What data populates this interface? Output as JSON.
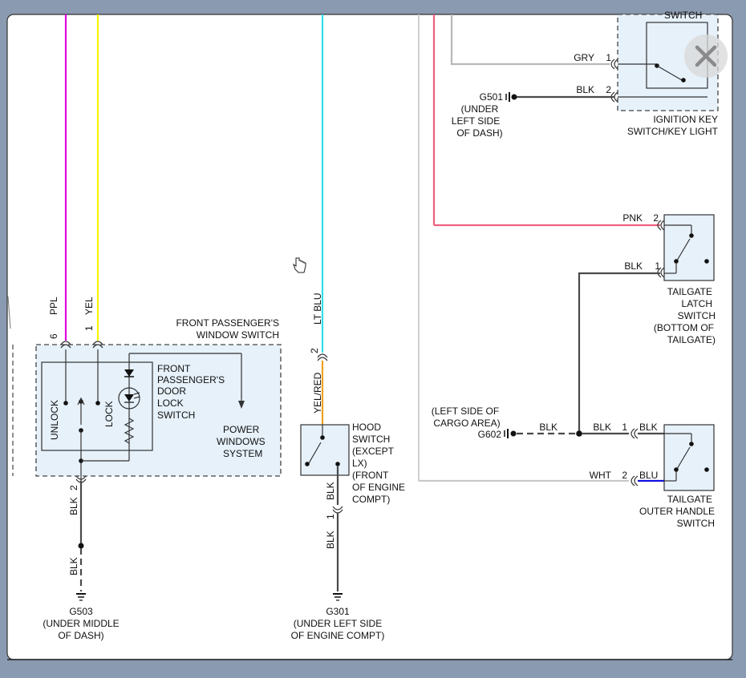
{
  "close_icon": "close-icon",
  "cursor_icon": "hand-pointer-icon",
  "wires": {
    "ppl": "PPL",
    "yel": "YEL",
    "lt_blu": "LT BLU",
    "yel_red": "YEL/RED",
    "blk": "BLK",
    "gry": "GRY",
    "pnk": "PNK",
    "wht": "WHT",
    "blu": "BLU"
  },
  "pins": {
    "p1": "1",
    "p2": "2",
    "p6": "6"
  },
  "components": {
    "window_switch": [
      "FRONT PASSENGER'S",
      "WINDOW SWITCH"
    ],
    "door_lock_switch": [
      "FRONT",
      "PASSENGER'S",
      "DOOR",
      "LOCK",
      "SWITCH"
    ],
    "power_windows": [
      "POWER",
      "WINDOWS",
      "SYSTEM"
    ],
    "unlock": "UNLOCK",
    "lock": "LOCK",
    "hood_switch": [
      "HOOD",
      "SWITCH",
      "(EXCEPT",
      "LX)",
      "(FRONT",
      "OF ENGINE",
      "COMPT)"
    ],
    "ignition_switch_top": "SWITCH",
    "ignition_switch": [
      "IGNITION KEY",
      "SWITCH/KEY LIGHT"
    ],
    "tailgate_latch": [
      "TAILGATE",
      "LATCH",
      "SWITCH",
      "(BOTTOM OF",
      "TAILGATE)"
    ],
    "tailgate_handle": [
      "TAILGATE",
      "OUTER HANDLE",
      "SWITCH"
    ]
  },
  "grounds": {
    "g501": [
      "G501",
      "(UNDER",
      "LEFT SIDE",
      "OF DASH)"
    ],
    "g503": [
      "G503",
      "(UNDER MIDDLE",
      "OF DASH)"
    ],
    "g301": [
      "G301",
      "(UNDER LEFT SIDE",
      "OF ENGINE COMPT)"
    ],
    "g602": [
      "(LEFT SIDE OF",
      "CARGO AREA)",
      "G602"
    ]
  },
  "colors": {
    "ppl": "#e000e0",
    "yel": "#f5f500",
    "lt_blu": "#2ee0e8",
    "yel_red": "#f0a020",
    "blk": "#4a4a4a",
    "gry": "#b8b8b8",
    "pnk": "#f06080",
    "blu": "#1010e0",
    "panel": "#e6f1fa"
  }
}
